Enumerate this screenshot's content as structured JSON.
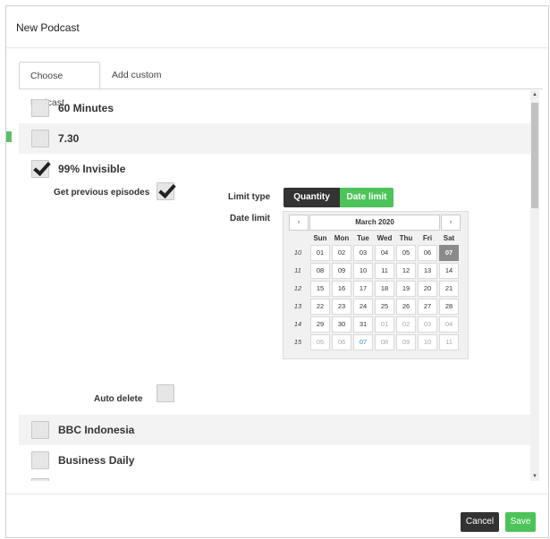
{
  "dialog": {
    "title": "New Podcast"
  },
  "tabs": [
    {
      "label": "Choose Podcast"
    },
    {
      "label": "Add custom"
    }
  ],
  "podcasts": [
    {
      "label": "60 Minutes",
      "checked": false
    },
    {
      "label": "7.30",
      "checked": false
    },
    {
      "label": "99% Invisible",
      "checked": true
    },
    {
      "label": "BBC Indonesia",
      "checked": false
    },
    {
      "label": "Business Daily",
      "checked": false
    }
  ],
  "settings": {
    "get_previous_label": "Get previous episodes",
    "get_previous_checked": true,
    "limit_type_label": "Limit type",
    "limit_options": [
      "Quantity",
      "Date limit"
    ],
    "limit_selected": "Date limit",
    "date_limit_label": "Date limit",
    "auto_delete_label": "Auto delete",
    "auto_delete_checked": false
  },
  "calendar": {
    "prev_icon": "prev-square-icon",
    "next_icon": "next-square-icon",
    "prev_glyph": "▫",
    "next_glyph": "▫",
    "month": "March 2020",
    "days_of_week": [
      "Sun",
      "Mon",
      "Tue",
      "Wed",
      "Thu",
      "Fri",
      "Sat"
    ],
    "weeks": [
      {
        "num": "10",
        "days": [
          "01",
          "02",
          "03",
          "04",
          "05",
          "06",
          "07"
        ]
      },
      {
        "num": "11",
        "days": [
          "08",
          "09",
          "10",
          "11",
          "12",
          "13",
          "14"
        ]
      },
      {
        "num": "12",
        "days": [
          "15",
          "16",
          "17",
          "18",
          "19",
          "20",
          "21"
        ]
      },
      {
        "num": "13",
        "days": [
          "22",
          "23",
          "24",
          "25",
          "26",
          "27",
          "28"
        ]
      },
      {
        "num": "14",
        "days": [
          "29",
          "30",
          "31",
          "01",
          "02",
          "03",
          "04"
        ]
      },
      {
        "num": "15",
        "days": [
          "05",
          "06",
          "07",
          "08",
          "09",
          "10",
          "11"
        ]
      }
    ],
    "selected": "07",
    "today_color": "#3a86c8"
  },
  "footer": {
    "cancel_label": "Cancel",
    "save_label": "Save"
  },
  "colors": {
    "accent_green": "#4cc45a",
    "dark_button": "#333333",
    "selected_day": "#8a8a8a"
  }
}
